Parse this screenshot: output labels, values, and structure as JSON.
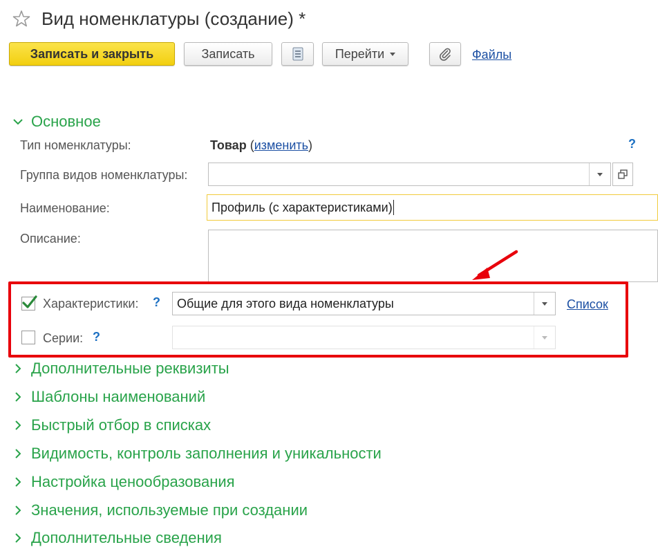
{
  "window": {
    "title": "Вид номенклатуры (создание) *"
  },
  "toolbar": {
    "save_close_label": "Записать и закрыть",
    "save_label": "Записать",
    "goto_label": "Перейти",
    "files_label": "Файлы"
  },
  "main_section": {
    "title": "Основное",
    "type_label": "Тип номенклатуры:",
    "type_value": "Товар",
    "type_paren_open": "(",
    "type_change_link": "изменить",
    "type_paren_close": ")",
    "help": "?",
    "group_label": "Группа видов номенклатуры:",
    "group_value": "",
    "name_label": "Наименование:",
    "name_value": "Профиль (с характеристиками)",
    "description_label": "Описание:",
    "description_value": ""
  },
  "highlight": {
    "characteristics": {
      "checked": true,
      "label": "Характеристики:",
      "help": "?",
      "value": "Общие для этого вида номенклатуры",
      "list_link": "Список"
    },
    "series": {
      "checked": false,
      "label": "Серии:",
      "help": "?",
      "value": ""
    }
  },
  "sections": [
    {
      "title": "Дополнительные реквизиты"
    },
    {
      "title": "Шаблоны наименований"
    },
    {
      "title": "Быстрый отбор в списках"
    },
    {
      "title": "Видимость, контроль заполнения и уникальности"
    },
    {
      "title": "Настройка ценообразования"
    },
    {
      "title": "Значения, используемые при создании"
    },
    {
      "title": "Дополнительные сведения"
    }
  ],
  "colors": {
    "section_green": "#29a34a",
    "link_blue": "#1b4fa3",
    "highlight_red": "#e8000b",
    "primary_yellow": "#f2cf10"
  }
}
